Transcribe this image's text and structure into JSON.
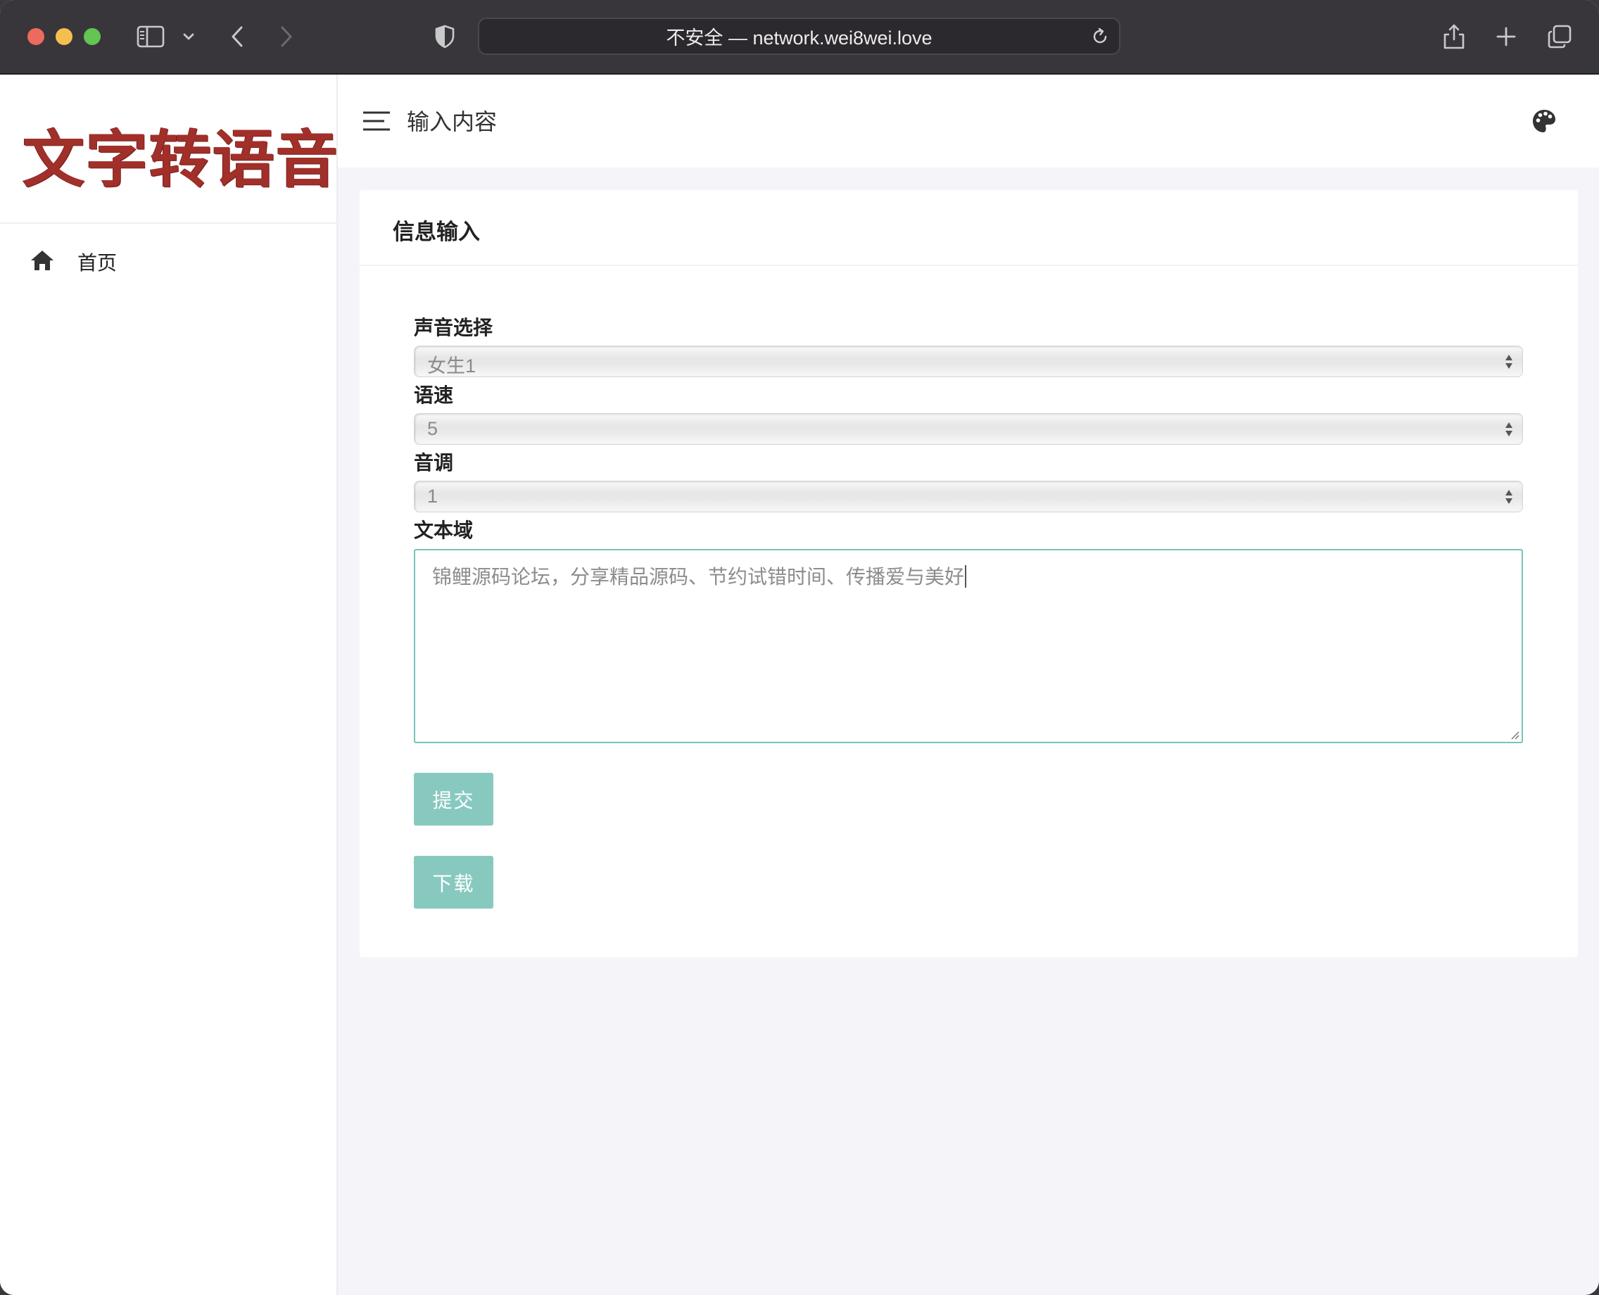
{
  "browser": {
    "url_text": "不安全 — network.wei8wei.love"
  },
  "sidebar": {
    "logo_text": "文字转语音",
    "items": [
      {
        "label": "首页",
        "icon": "home-icon"
      }
    ]
  },
  "header": {
    "title": "输入内容",
    "right_icon": "palette-icon"
  },
  "card": {
    "title": "信息输入"
  },
  "form": {
    "voice": {
      "label": "声音选择",
      "value": "女生1"
    },
    "speed": {
      "label": "语速",
      "value": "5"
    },
    "pitch": {
      "label": "音调",
      "value": "1"
    },
    "text": {
      "label": "文本域",
      "value": "锦鲤源码论坛，分享精品源码、节约试错时间、传播爱与美好"
    },
    "submit_label": "提交",
    "download_label": "下载"
  },
  "colors": {
    "logo": "#a1302a",
    "button": "#88c9bf",
    "focus_border": "#76c4b7",
    "chrome": "#38363b"
  }
}
